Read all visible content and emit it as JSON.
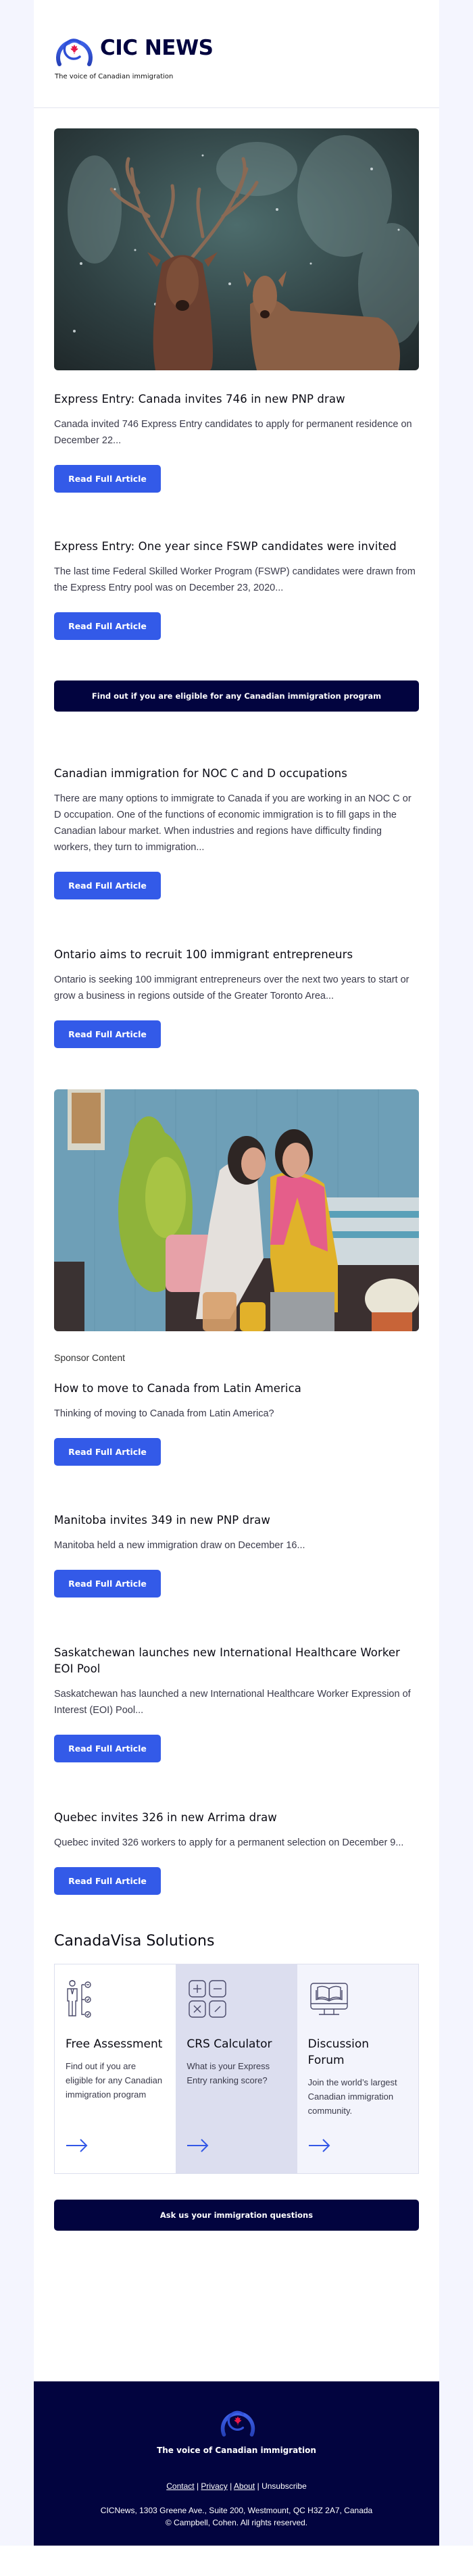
{
  "brand": {
    "name": "CIC NEWS",
    "tagline": "The voice of Canadian immigration",
    "colors": {
      "primary_blue": "#335ae8",
      "navy": "#02043f",
      "maple_red": "#e8194a",
      "page_bg": "#f4f5fe"
    }
  },
  "articles": [
    {
      "image": "deer-in-snowy-forest",
      "title": "Express Entry: Canada invites 746 in new PNP draw",
      "desc": "Canada invited 746 Express Entry candidates to apply for permanent residence on December 22...",
      "button": "Read Full Article"
    },
    {
      "title": "Express Entry: One year since FSWP candidates were invited",
      "desc": "The last time Federal Skilled Worker Program (FSWP) candidates were drawn from the Express Entry pool was on December 23, 2020...",
      "button": "Read Full Article"
    },
    {
      "title": "Canadian immigration for NOC C and D occupations",
      "desc": "There are many options to immigrate to Canada if you are working in an NOC C or D occupation. One of the functions of economic immigration is to fill gaps in the Canadian labour market. When industries and regions have difficulty finding workers, they turn to immigration...",
      "button": "Read Full Article"
    },
    {
      "title": "Ontario aims to recruit 100 immigrant entrepreneurs",
      "desc": "Ontario is seeking 100 immigrant entrepreneurs over the next two years to start or grow a business in regions outside of the Greater Toronto Area...",
      "button": "Read Full Article"
    },
    {
      "image": "two-women-on-patio-sofa",
      "label": "Sponsor Content",
      "title": "How to move to Canada from Latin America",
      "desc": "Thinking of moving to Canada from Latin America?",
      "button": "Read Full Article"
    },
    {
      "title": "Manitoba invites 349 in new PNP draw",
      "desc": "Manitoba held a new immigration draw on December 16...",
      "button": "Read Full Article"
    },
    {
      "title": "Saskatchewan launches new International Healthcare Worker EOI Pool",
      "desc": "Saskatchewan has launched a new International Healthcare Worker Expression of Interest (EOI) Pool...",
      "button": "Read Full Article"
    },
    {
      "title": "Quebec invites 326 in new Arrima draw",
      "desc": "Quebec invited 326 workers to apply for a permanent selection on December 9...",
      "button": "Read Full Article"
    }
  ],
  "eligibility_cta": "Find out if you are eligible for any Canadian immigration program",
  "solutions": {
    "title": "CanadaVisa Solutions",
    "cards": [
      {
        "icon": "assessment-checklist-icon",
        "title": "Free Assessment",
        "desc": "Find out if you are eligible for any Canadian immigration program"
      },
      {
        "icon": "calculator-icon",
        "title": "CRS Calculator",
        "desc": "What is your Express Entry ranking score?"
      },
      {
        "icon": "forum-book-monitor-icon",
        "title": "Discussion Forum",
        "desc": "Join the world’s largest Canadian immigration community."
      }
    ]
  },
  "questions_cta": "Ask us your immigration questions",
  "footer": {
    "tagline": "The voice of Canadian immigration",
    "links": [
      "Contact",
      "Privacy",
      "About",
      "Unsubscribe"
    ],
    "separator": "|",
    "address": "CICNews, 1303 Greene Ave., Suite 200, Westmount, QC H3Z 2A7, Canada",
    "copyright": "© Campbell, Cohen. All rights reserved."
  }
}
